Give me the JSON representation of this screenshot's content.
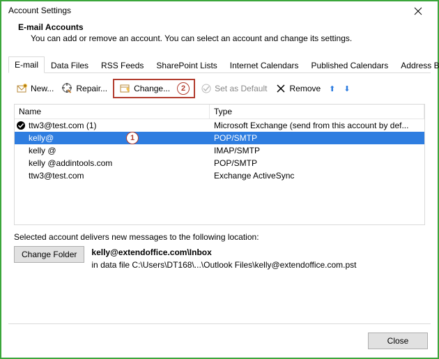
{
  "window": {
    "title": "Account Settings"
  },
  "header": {
    "heading": "E-mail Accounts",
    "subtitle": "You can add or remove an account. You can select an account and change its settings."
  },
  "tabs": [
    "E-mail",
    "Data Files",
    "RSS Feeds",
    "SharePoint Lists",
    "Internet Calendars",
    "Published Calendars",
    "Address Books"
  ],
  "toolbar": {
    "new_label": "New...",
    "repair_label": "Repair...",
    "change_label": "Change...",
    "set_default_label": "Set as Default",
    "remove_label": "Remove"
  },
  "callouts": {
    "one": "1",
    "two": "2"
  },
  "columns": {
    "name": "Name",
    "type": "Type"
  },
  "accounts": [
    {
      "name": "ttw3@test.com (1)",
      "type": "Microsoft Exchange (send from this account by def...",
      "default": true,
      "selected": false
    },
    {
      "name": "kelly@",
      "type": "POP/SMTP",
      "default": false,
      "selected": true
    },
    {
      "name": "kelly          @",
      "type": "IMAP/SMTP",
      "default": false,
      "selected": false
    },
    {
      "name": "kelly      @addintools.com",
      "type": "POP/SMTP",
      "default": false,
      "selected": false
    },
    {
      "name": "ttw3@test.com",
      "type": "Exchange ActiveSync",
      "default": false,
      "selected": false
    }
  ],
  "delivery": {
    "intro": "Selected account delivers new messages to the following location:",
    "change_folder_label": "Change Folder",
    "location_bold": "kelly@extendoffice.com\\Inbox",
    "location_path": "in data file C:\\Users\\DT168\\...\\Outlook Files\\kelly@extendoffice.com.pst"
  },
  "footer": {
    "close_label": "Close"
  }
}
